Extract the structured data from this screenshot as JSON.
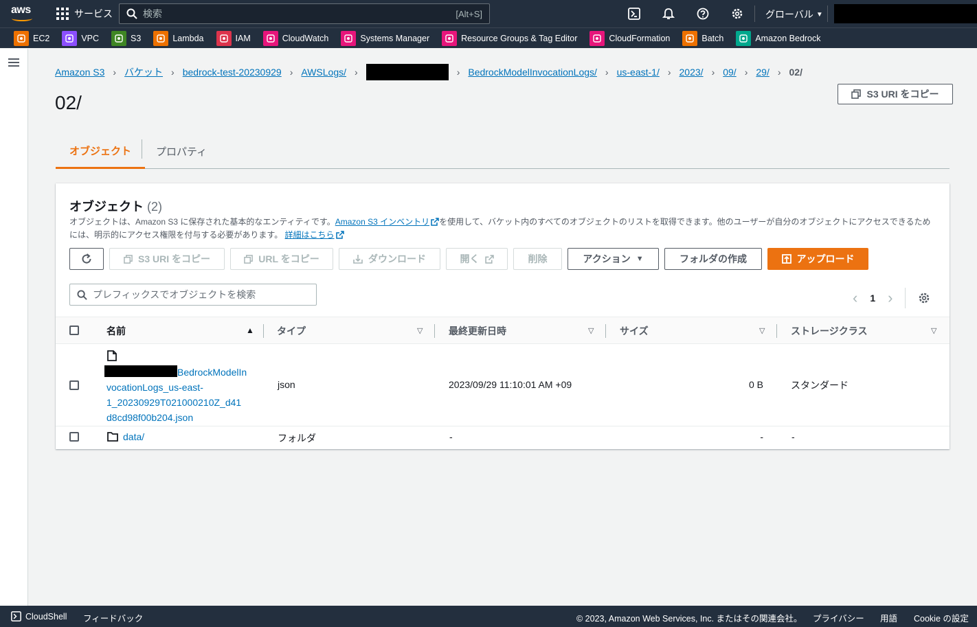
{
  "topnav": {
    "logo_text": "aws",
    "services_label": "サービス",
    "search_placeholder": "検索",
    "search_shortcut": "[Alt+S]",
    "region_label": "グローバル"
  },
  "favorites": [
    {
      "label": "EC2",
      "color": "#ed7100",
      "icon": "ec2-icon"
    },
    {
      "label": "VPC",
      "color": "#8c4fff",
      "icon": "vpc-icon"
    },
    {
      "label": "S3",
      "color": "#3f8624",
      "icon": "s3-icon"
    },
    {
      "label": "Lambda",
      "color": "#ed7100",
      "icon": "lambda-icon"
    },
    {
      "label": "IAM",
      "color": "#dd344c",
      "icon": "iam-icon"
    },
    {
      "label": "CloudWatch",
      "color": "#e7157b",
      "icon": "cloudwatch-icon"
    },
    {
      "label": "Systems Manager",
      "color": "#e7157b",
      "icon": "systems-manager-icon"
    },
    {
      "label": "Resource Groups & Tag Editor",
      "color": "#e7157b",
      "icon": "resource-groups-icon"
    },
    {
      "label": "CloudFormation",
      "color": "#e7157b",
      "icon": "cloudformation-icon"
    },
    {
      "label": "Batch",
      "color": "#ed7100",
      "icon": "batch-icon"
    },
    {
      "label": "Amazon Bedrock",
      "color": "#01a88d",
      "icon": "bedrock-icon"
    }
  ],
  "breadcrumb": {
    "items": [
      "Amazon S3",
      "バケット",
      "bedrock-test-20230929",
      "AWSLogs/",
      "BedrockModelInvocationLogs/",
      "us-east-1/",
      "2023/",
      "09/",
      "29/"
    ],
    "current": "02/"
  },
  "page": {
    "title": "02/",
    "copy_uri_label": "S3 URI をコピー"
  },
  "tabs": [
    {
      "label": "オブジェクト",
      "active": true
    },
    {
      "label": "プロパティ",
      "active": false
    }
  ],
  "objects_panel": {
    "title": "オブジェクト",
    "count": "(2)",
    "desc_part1": "オブジェクトは、Amazon S3 に保存された基本的なエンティティです。",
    "desc_link1": "Amazon S3 インベントリ",
    "desc_part2": "を使用して、バケット内のすべてのオブジェクトのリストを取得できます。他のユーザーが自分のオブジェクトにアクセスできるためには、明示的にアクセス権限を付与する必要があります。",
    "desc_link2": "詳細はこちら",
    "buttons": {
      "copy_s3_uri": "S3 URI をコピー",
      "copy_url": "URL をコピー",
      "download": "ダウンロード",
      "open": "開く",
      "delete": "削除",
      "actions": "アクション",
      "create_folder": "フォルダの作成",
      "upload": "アップロード"
    },
    "filter_placeholder": "プレフィックスでオブジェクトを検索",
    "page_number": "1",
    "columns": [
      "名前",
      "タイプ",
      "最終更新日時",
      "サイズ",
      "ストレージクラス"
    ],
    "rows": [
      {
        "name_line1": "BedrockModelIn",
        "name_line2": "vocationLogs_us-east-",
        "name_line3": "1_20230929T021000210Z_d41",
        "name_line4": "d8cd98f00b204.json",
        "type": "json",
        "last_modified": "2023/09/29 11:10:01 AM +09",
        "size": "0 B",
        "storage_class": "スタンダード"
      },
      {
        "name": "data/",
        "type": "フォルダ",
        "last_modified": "-",
        "size": "-",
        "storage_class": "-"
      }
    ]
  },
  "footer": {
    "cloudshell": "CloudShell",
    "feedback": "フィードバック",
    "copyright": "© 2023, Amazon Web Services, Inc. またはその関連会社。",
    "privacy": "プライバシー",
    "terms": "用語",
    "cookie": "Cookie の設定"
  }
}
